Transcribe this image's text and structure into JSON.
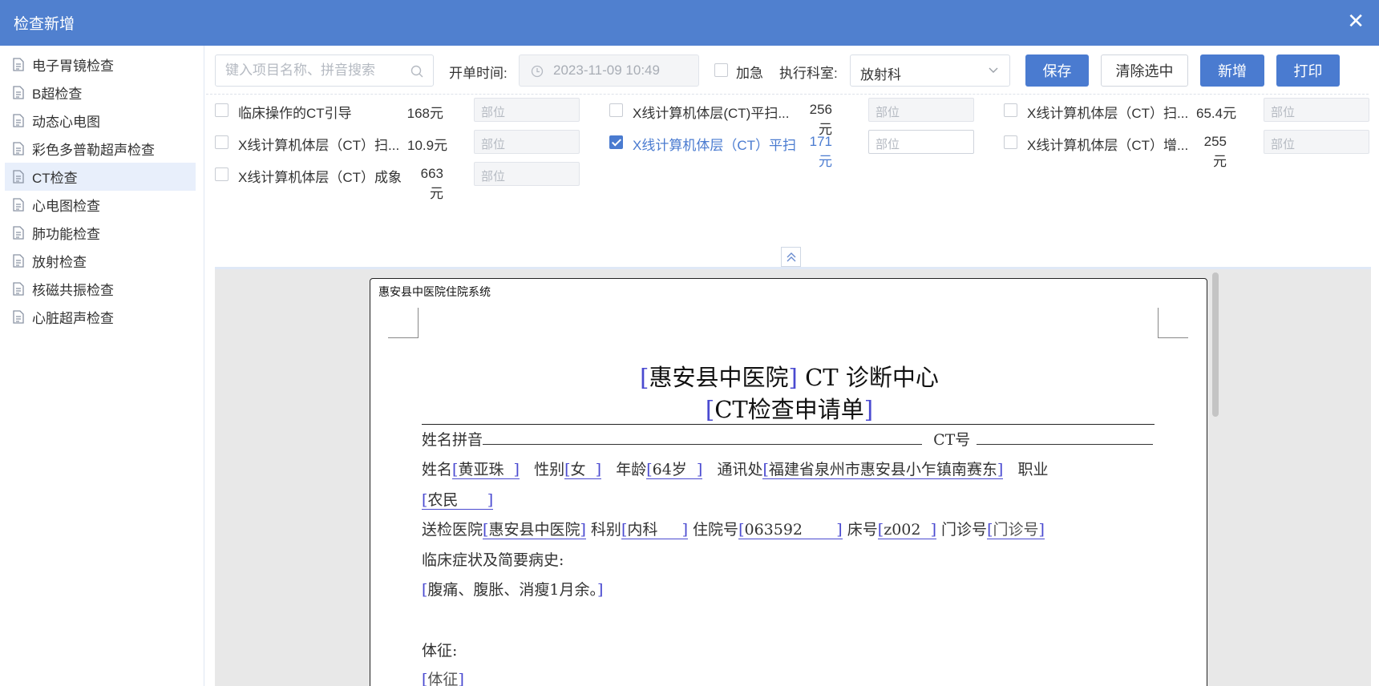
{
  "window": {
    "title": "检查新增",
    "close_label": "✕"
  },
  "sidebar": {
    "items": [
      {
        "label": "电子胃镜检查",
        "active": false
      },
      {
        "label": "B超检查",
        "active": false
      },
      {
        "label": "动态心电图",
        "active": false
      },
      {
        "label": "彩色多普勒超声检查",
        "active": false
      },
      {
        "label": "CT检查",
        "active": true
      },
      {
        "label": "心电图检查",
        "active": false
      },
      {
        "label": "肺功能检查",
        "active": false
      },
      {
        "label": "放射检查",
        "active": false
      },
      {
        "label": "核磁共振检查",
        "active": false
      },
      {
        "label": "心脏超声检查",
        "active": false
      }
    ]
  },
  "toolbar": {
    "search_placeholder": "键入项目名称、拼音搜索",
    "open_time_label": "开单时间:",
    "open_time_value": "2023-11-09 10:49",
    "urgent_label": "加急",
    "urgent_checked": false,
    "dept_label": "执行科室:",
    "dept_value": "放射科",
    "save_label": "保存",
    "clear_label": "清除选中",
    "add_label": "新增",
    "print_label": "打印"
  },
  "items": [
    {
      "name": "临床操作的CT引导",
      "price": "168元",
      "part_placeholder": "部位",
      "checked": false
    },
    {
      "name": "X线计算机体层(CT)平扫...",
      "price": "256元",
      "part_placeholder": "部位",
      "checked": false
    },
    {
      "name": "X线计算机体层（CT）扫...",
      "price": "65.4元",
      "part_placeholder": "部位",
      "checked": false
    },
    {
      "name": "X线计算机体层（CT）扫...",
      "price": "10.9元",
      "part_placeholder": "部位",
      "checked": false
    },
    {
      "name": "X线计算机体层（CT）平扫",
      "price": "171元",
      "part_placeholder": "部位",
      "checked": true
    },
    {
      "name": "X线计算机体层（CT）增...",
      "price": "255元",
      "part_placeholder": "部位",
      "checked": false
    },
    {
      "name": "X线计算机体层（CT）成象",
      "price": "663元",
      "part_placeholder": "部位",
      "checked": false
    }
  ],
  "document": {
    "system_name": "惠安县中医院住院系统",
    "hospital": "惠安县中医院",
    "center": "CT 诊断中心",
    "form_title": "CT检查申请单",
    "pinyin_label": "姓名拼音",
    "ct_no_label": "CT号",
    "name_label": "姓名",
    "name_value": "黄亚珠",
    "gender_label": "性别",
    "gender_value": "女",
    "age_label": "年龄",
    "age_value": "64岁",
    "address_label": "通讯处",
    "address_value": "福建省泉州市惠安县小乍镇南赛东",
    "job_label": "职业",
    "job_value": "农民",
    "send_hospital_label": "送检医院",
    "send_hospital_value": "惠安县中医院",
    "dept_label": "科别",
    "dept_value": "内科",
    "inpatient_no_label": "住院号",
    "inpatient_no_value": "063592",
    "bed_label": "床号",
    "bed_value": "z002",
    "outpatient_label": "门诊号",
    "outpatient_value": "门诊号",
    "history_label": "临床症状及简要病史:",
    "history_value": "腹痛、腹胀、消瘦1月余。",
    "sign_label": "体征:",
    "sign_value": "体征"
  },
  "colors": {
    "header": "#5080cf",
    "primary": "#4a7bd0",
    "bracket": "#4a4ad0"
  }
}
